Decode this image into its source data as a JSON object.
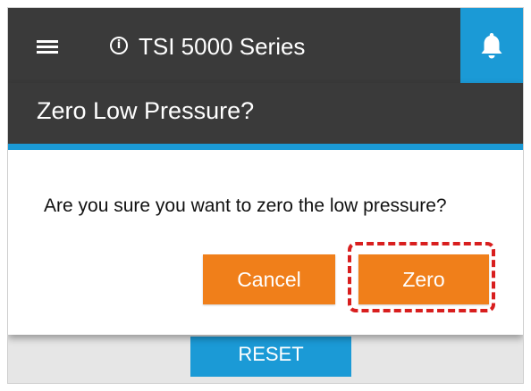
{
  "appbar": {
    "title": "TSI 5000 Series",
    "menu_icon": "hamburger-menu-icon",
    "info_icon": "info-circle-icon",
    "info_glyph": "i",
    "bell_icon": "bell-icon"
  },
  "dialog": {
    "title": "Zero Low Pressure?",
    "message": "Are you sure you want to zero the low pressure?",
    "cancel_label": "Cancel",
    "zero_label": "Zero"
  },
  "background": {
    "reset_label": "RESET"
  },
  "colors": {
    "header_bg": "#3a3a3a",
    "accent_blue": "#1b9ad6",
    "button_orange": "#f07f1a",
    "highlight_red": "#d81e1e",
    "backdrop_gray": "#e6e6e6"
  }
}
